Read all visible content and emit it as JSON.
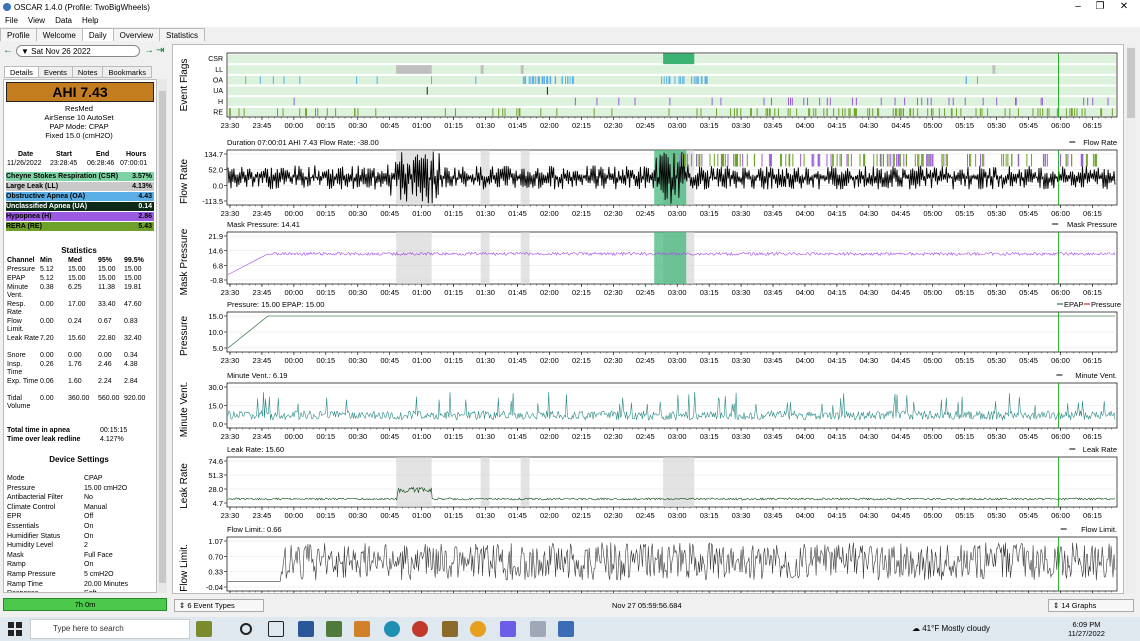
{
  "window": {
    "title": "OSCAR 1.4.0 (Profile: TwoBigWheels)"
  },
  "menu": [
    "File",
    "View",
    "Data",
    "Help"
  ],
  "tabs": [
    "Profile",
    "Welcome",
    "Daily",
    "Overview",
    "Statistics"
  ],
  "date": "Sat Nov 26 2022",
  "side_tabs": [
    "Details",
    "Events",
    "Notes",
    "Bookmarks"
  ],
  "summary": {
    "ahi": "AHI 7.43",
    "brand": "ResMed",
    "model": "AirSense 10 AutoSet",
    "mode": "PAP Mode: CPAP",
    "fixed": "Fixed 15.0 (cmH2O)"
  },
  "session": {
    "headers": [
      "Date",
      "Start",
      "End",
      "Hours"
    ],
    "values": [
      "11/26/2022",
      "23:28:45",
      "06:28:46",
      "07:00:01"
    ]
  },
  "events": [
    {
      "label": "Cheyne Stokes Respiration (CSR)",
      "value": "3.57%",
      "color": "#7ed3a4"
    },
    {
      "label": "Large Leak (LL)",
      "value": "4.13%",
      "color": "#c9c9c9"
    },
    {
      "label": "Obstructive Apnea (OA)",
      "value": "4.43",
      "color": "#5aaee6"
    },
    {
      "label": "Unclassified Apnea (UA)",
      "value": "0.14",
      "color": "#0c2a16"
    },
    {
      "label": "Hypopnea (H)",
      "value": "2.86",
      "color": "#9a5be0"
    },
    {
      "label": "RERA (RE)",
      "value": "5.43",
      "color": "#6fa12a"
    }
  ],
  "statistics": {
    "title": "Statistics",
    "headers": [
      "Channel",
      "Min",
      "Med",
      "95%",
      "99.5%"
    ],
    "rows": [
      [
        "Pressure",
        "5.12",
        "15.00",
        "15.00",
        "15.00"
      ],
      [
        "EPAP",
        "5.12",
        "15.00",
        "15.00",
        "15.00"
      ],
      [
        "Minute Vent.",
        "0.38",
        "6.25",
        "11.38",
        "19.81"
      ],
      [
        "Resp. Rate",
        "0.00",
        "17.00",
        "33.40",
        "47.60"
      ],
      [
        "Flow Limit.",
        "0.00",
        "0.24",
        "0.67",
        "0.83"
      ],
      [
        "Leak Rate",
        "7.20",
        "15.60",
        "22.80",
        "32.40"
      ],
      [
        "Snore",
        "0.00",
        "0.00",
        "0.00",
        "0.34"
      ],
      [
        "Insp. Time",
        "0.26",
        "1.76",
        "2.46",
        "4.38"
      ],
      [
        "Exp. Time",
        "0.06",
        "1.60",
        "2.24",
        "2.84"
      ],
      [
        "Tidal Volume",
        "0.00",
        "360.00",
        "560.00",
        "920.00"
      ]
    ],
    "apnea_time_label": "Total time in apnea",
    "apnea_time": "00:15:15",
    "leak_label": "Time over leak redline",
    "leak_value": "4.127%"
  },
  "device": {
    "title": "Device Settings",
    "rows": [
      [
        "Mode",
        "CPAP"
      ],
      [
        "Pressure",
        "15.00 cmH2O"
      ],
      [
        "Antibacterial Filter",
        "No"
      ],
      [
        "Climate Control",
        "Manual"
      ],
      [
        "EPR",
        "Off"
      ],
      [
        "Essentials",
        "On"
      ],
      [
        "Humidifier Status",
        "On"
      ],
      [
        "Humidity Level",
        "2"
      ],
      [
        "Mask",
        "Full Face"
      ],
      [
        "Ramp",
        "On"
      ],
      [
        "Ramp Pressure",
        "5 cmH2O"
      ],
      [
        "Ramp Time",
        "20.00 Minutes"
      ],
      [
        "Response",
        "Soft"
      ]
    ]
  },
  "status_left": "7h 0m",
  "bottom": {
    "event_types": "6 Event Types",
    "datetime": "Nov 27 05:59:56.684",
    "graphs": "14 Graphs"
  },
  "time_ticks": [
    "23:30",
    "23:45",
    "00:00",
    "00:15",
    "00:30",
    "00:45",
    "01:00",
    "01:15",
    "01:30",
    "01:45",
    "02:00",
    "02:15",
    "02:30",
    "02:45",
    "03:00",
    "03:15",
    "03:30",
    "03:45",
    "04:00",
    "04:15",
    "04:30",
    "04:45",
    "05:00",
    "05:15",
    "05:30",
    "05:45",
    "06:00",
    "06:15"
  ],
  "graphs": [
    {
      "key": "flags",
      "ylabel": "Event Flags",
      "rows": [
        "CSR",
        "LL",
        "OA",
        "UA",
        "H",
        "RE"
      ]
    },
    {
      "key": "flow",
      "ylabel": "Flow Rate",
      "caption": "Duration 07:00:01 AHI 7.43 Flow Rate: -38.00",
      "legend": "Flow Rate",
      "ticks": [
        "134.7",
        "52.0",
        "0.0",
        "-113.5"
      ],
      "color": "#000000"
    },
    {
      "key": "mask",
      "ylabel": "Mask Pressure",
      "caption": "Mask Pressure: 14.41",
      "legend": "Mask Pressure",
      "ticks": [
        "21.9",
        "14.6",
        "6.8",
        "-0.8"
      ],
      "color": "#a34be6"
    },
    {
      "key": "pressure",
      "ylabel": "Pressure",
      "caption": "Pressure: 15.00 EPAP: 15.00",
      "legend": "EPAP",
      "legend2": "Pressure",
      "ticks": [
        "15.0",
        "10.0",
        "5.0"
      ],
      "color": "#0b5a1f"
    },
    {
      "key": "minvent",
      "ylabel": "Minute Vent.",
      "caption": "Minute Vent.: 6.19",
      "legend": "Minute Vent.",
      "ticks": [
        "30.0",
        "15.0",
        "0.0"
      ],
      "color": "#2b8a86"
    },
    {
      "key": "leak",
      "ylabel": "Leak Rate",
      "caption": "Leak Rate: 15.60",
      "legend": "Leak Rate",
      "ticks": [
        "74.6",
        "51.3",
        "28.0",
        "4.7"
      ],
      "color": "#0b4a14"
    },
    {
      "key": "flowlim",
      "ylabel": "Flow Limit.",
      "caption": "Flow Limit.: 0.66",
      "legend": "Flow Limit.",
      "ticks": [
        "1.07",
        "0.70",
        "0.33",
        "-0.04"
      ],
      "color": "#3a3a3a"
    }
  ],
  "taskbar": {
    "search": "Type here to search",
    "weather": "41°F  Mostly cloudy",
    "time": "6:09 PM",
    "date": "11/27/2022"
  },
  "colors": {
    "csr": "#7ed3a4",
    "ll": "#c9c9c9",
    "oa": "#5aaee6",
    "ua": "#0c2a16",
    "h": "#9a5be0",
    "re": "#6fa12a",
    "ahi": "#c47d1e",
    "status": "#4cc84c"
  }
}
